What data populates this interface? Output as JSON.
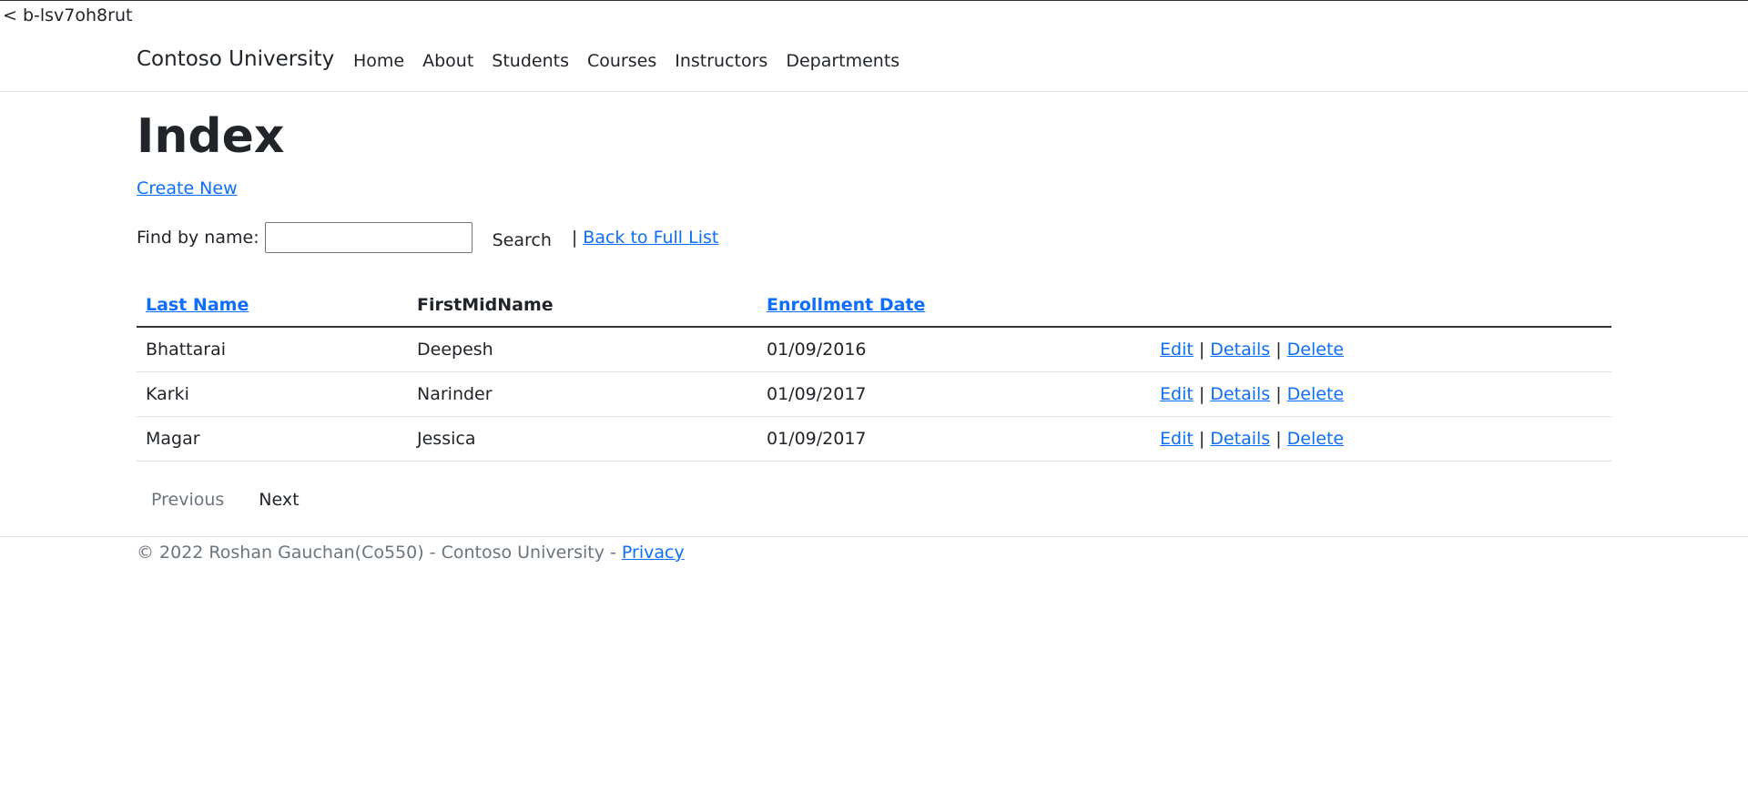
{
  "frame_id": "< b-lsv7oh8rut",
  "navbar": {
    "brand": "Contoso University",
    "items": [
      "Home",
      "About",
      "Students",
      "Courses",
      "Instructors",
      "Departments"
    ]
  },
  "page": {
    "title": "Index",
    "create_link": "Create New"
  },
  "search": {
    "label": "Find by name:",
    "value": "",
    "button": "Search",
    "separator": "|",
    "back_link": "Back to Full List"
  },
  "table": {
    "headers": [
      "Last Name",
      "FirstMidName",
      "Enrollment Date"
    ],
    "rows": [
      {
        "last": "Bhattarai",
        "first": "Deepesh",
        "date": "01/09/2016"
      },
      {
        "last": "Karki",
        "first": "Narinder",
        "date": "01/09/2017"
      },
      {
        "last": "Magar",
        "first": "Jessica",
        "date": "01/09/2017"
      }
    ],
    "actions": {
      "edit": "Edit",
      "details": "Details",
      "delete": "Delete",
      "sep": "|"
    }
  },
  "pager": {
    "previous": "Previous",
    "next": "Next"
  },
  "footer": {
    "text": "© 2022 Roshan Gauchan(Co550) - Contoso University - ",
    "privacy": "Privacy"
  }
}
